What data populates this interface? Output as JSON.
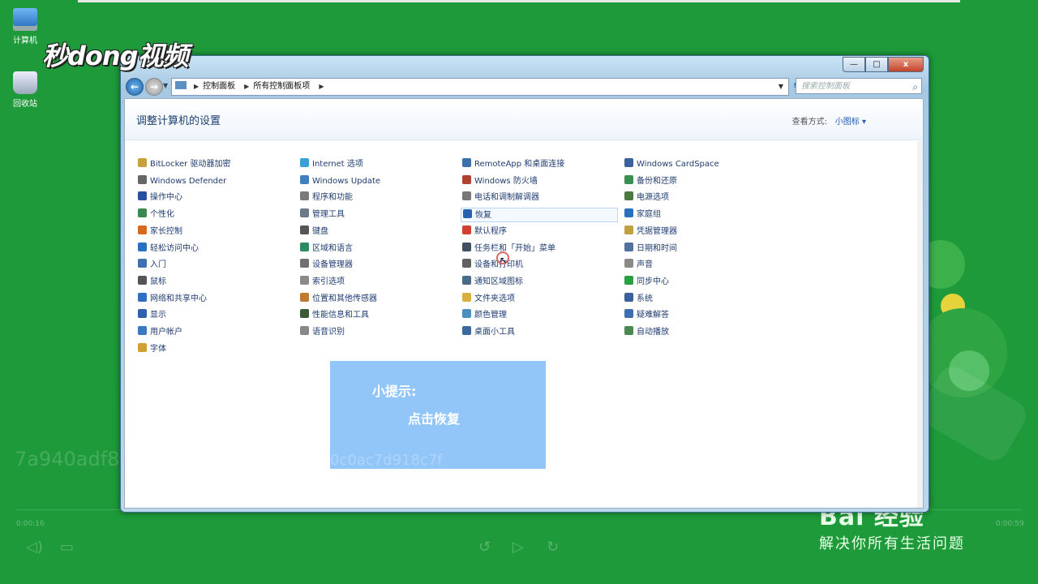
{
  "desktop": {
    "icons": [
      {
        "label": "计算机"
      },
      {
        "label": "回收站"
      }
    ]
  },
  "overlay": {
    "brand": "秒dong视频",
    "watermark_id": "7a940adf8",
    "tip_ghost": "0c0ac7d918c7f",
    "baidu_logo": "Bai 经验",
    "baidu_slogan": "解决你所有生活问题",
    "time_left": "0:00:16",
    "time_right": "0:00:59"
  },
  "window": {
    "controls": {
      "minimize": "—",
      "maximize": "□",
      "close": "x"
    },
    "address": {
      "crumbs": [
        "控制面板",
        "所有控制面板项"
      ]
    },
    "search": {
      "placeholder": "搜索控制面板"
    },
    "header": {
      "title": "调整计算机的设置",
      "view_label": "查看方式:",
      "view_value": "小图标 ▾"
    },
    "columns": [
      [
        {
          "label": "BitLocker 驱动器加密",
          "color": "#c8a040"
        },
        {
          "label": "Windows Defender",
          "color": "#666666"
        },
        {
          "label": "操作中心",
          "color": "#2850a0"
        },
        {
          "label": "个性化",
          "color": "#3a8a50"
        },
        {
          "label": "家长控制",
          "color": "#d86a20"
        },
        {
          "label": "轻松访问中心",
          "color": "#2a70c0"
        },
        {
          "label": "入门",
          "color": "#4070b0"
        },
        {
          "label": "鼠标",
          "color": "#555555"
        },
        {
          "label": "网络和共享中心",
          "color": "#2f6fc5"
        },
        {
          "label": "显示",
          "color": "#3060b0"
        },
        {
          "label": "用户帐户",
          "color": "#3a7ac0"
        },
        {
          "label": "字体",
          "color": "#d0a030"
        }
      ],
      [
        {
          "label": "Internet 选项",
          "color": "#3aa0d8"
        },
        {
          "label": "Windows Update",
          "color": "#4080c0"
        },
        {
          "label": "程序和功能",
          "color": "#7a7a7a"
        },
        {
          "label": "管理工具",
          "color": "#6a7a8a"
        },
        {
          "label": "键盘",
          "color": "#555555"
        },
        {
          "label": "区域和语言",
          "color": "#2a8a60"
        },
        {
          "label": "设备管理器",
          "color": "#707070"
        },
        {
          "label": "索引选项",
          "color": "#8a8a8a"
        },
        {
          "label": "位置和其他传感器",
          "color": "#c07a30"
        },
        {
          "label": "性能信息和工具",
          "color": "#3a5a3a"
        },
        {
          "label": "语音识别",
          "color": "#888888"
        }
      ],
      [
        {
          "label": "RemoteApp 和桌面连接",
          "color": "#3a70b0"
        },
        {
          "label": "Windows 防火墙",
          "color": "#b04030"
        },
        {
          "label": "电话和调制解调器",
          "color": "#777777"
        },
        {
          "label": "恢复",
          "color": "#2a60b0",
          "hover": true
        },
        {
          "label": "默认程序",
          "color": "#d04030"
        },
        {
          "label": "任务栏和「开始」菜单",
          "color": "#405060"
        },
        {
          "label": "设备和打印机",
          "color": "#606060"
        },
        {
          "label": "通知区域图标",
          "color": "#4a6a8a"
        },
        {
          "label": "文件夹选项",
          "color": "#d8b040"
        },
        {
          "label": "颜色管理",
          "color": "#4a90c0"
        },
        {
          "label": "桌面小工具",
          "color": "#3a6aa0"
        }
      ],
      [
        {
          "label": "Windows CardSpace",
          "color": "#3a60a0"
        },
        {
          "label": "备份和还原",
          "color": "#3a9050"
        },
        {
          "label": "电源选项",
          "color": "#4a7a40"
        },
        {
          "label": "家庭组",
          "color": "#2a70c0"
        },
        {
          "label": "凭据管理器",
          "color": "#c0a040"
        },
        {
          "label": "日期和时间",
          "color": "#5070a0"
        },
        {
          "label": "声音",
          "color": "#8a8a8a"
        },
        {
          "label": "同步中心",
          "color": "#2aa040"
        },
        {
          "label": "系统",
          "color": "#3a60a0"
        },
        {
          "label": "疑难解答",
          "color": "#3a70b0"
        },
        {
          "label": "自动播放",
          "color": "#4a8a50"
        }
      ]
    ],
    "tip": {
      "title": "小提示:",
      "body": "点击恢复"
    }
  }
}
